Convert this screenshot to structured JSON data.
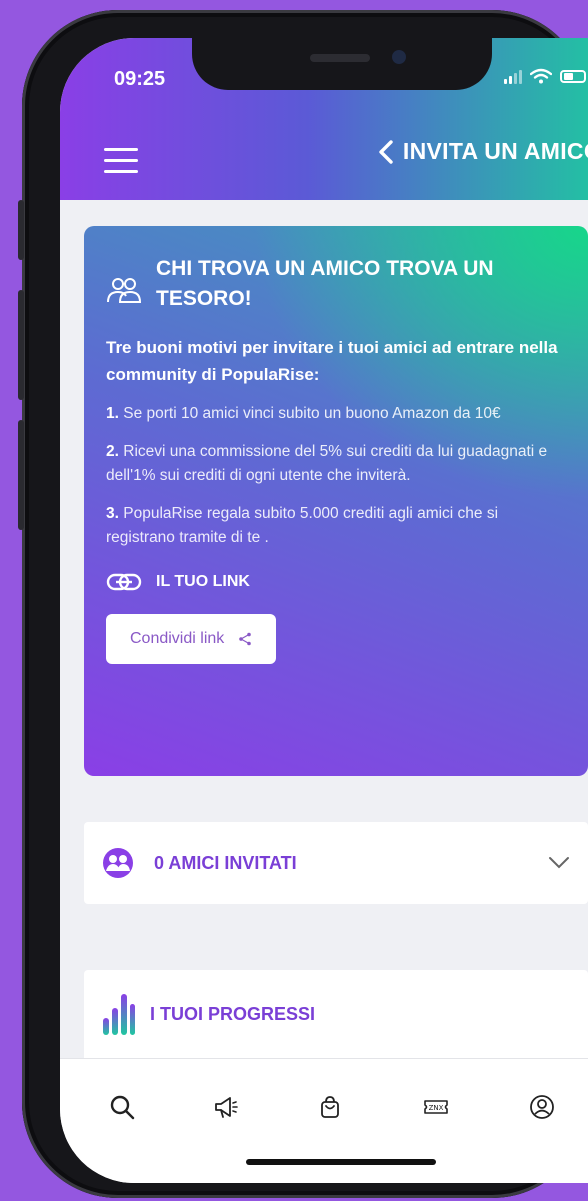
{
  "status_bar": {
    "time": "09:25"
  },
  "header": {
    "title": "INVITA UN AMICO!"
  },
  "invite_card": {
    "title": "CHI TROVA UN AMICO TROVA UN TESORO!",
    "intro": "Tre buoni motivi per invitare i tuoi amici ad entrare nella community di PopulaRise:",
    "reasons": [
      {
        "num": "1.",
        "text": "Se porti 10 amici vinci subito un buono Amazon da 10€"
      },
      {
        "num": "2.",
        "text": "Ricevi una commissione del 5% sui crediti da lui guadagnati e dell'1% sui crediti di ogni utente che inviterà."
      },
      {
        "num": "3.",
        "text": "PopulaRise regala subito 5.000 crediti agli amici che si registrano tramite di te ."
      }
    ],
    "link_label": "IL TUO LINK",
    "share_button": "Condividi link"
  },
  "friends": {
    "label": "0 AMICI INVITATI"
  },
  "progress": {
    "label": "I TUOI PROGRESSI"
  },
  "nav": [
    "search-icon",
    "megaphone-icon",
    "shopping-bag-icon",
    "ticket-icon",
    "profile-icon"
  ],
  "colors": {
    "accent": "#7a3fd6",
    "gradient_start": "#8a3fe6",
    "gradient_end": "#1fc7a0"
  }
}
